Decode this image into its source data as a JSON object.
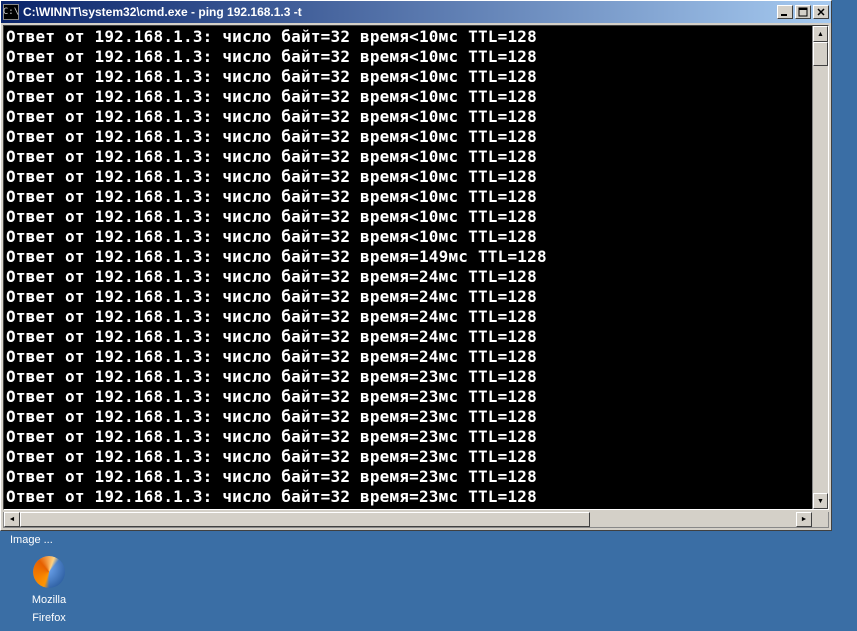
{
  "window": {
    "title": "C:\\WINNT\\system32\\cmd.exe - ping 192.168.1.3 -t",
    "icon_text": "C:\\"
  },
  "console": {
    "lines": [
      "Ответ от 192.168.1.3: число байт=32 время<10мс TTL=128",
      "Ответ от 192.168.1.3: число байт=32 время<10мс TTL=128",
      "Ответ от 192.168.1.3: число байт=32 время<10мс TTL=128",
      "Ответ от 192.168.1.3: число байт=32 время<10мс TTL=128",
      "Ответ от 192.168.1.3: число байт=32 время<10мс TTL=128",
      "Ответ от 192.168.1.3: число байт=32 время<10мс TTL=128",
      "Ответ от 192.168.1.3: число байт=32 время<10мс TTL=128",
      "Ответ от 192.168.1.3: число байт=32 время<10мс TTL=128",
      "Ответ от 192.168.1.3: число байт=32 время<10мс TTL=128",
      "Ответ от 192.168.1.3: число байт=32 время<10мс TTL=128",
      "Ответ от 192.168.1.3: число байт=32 время<10мс TTL=128",
      "Ответ от 192.168.1.3: число байт=32 время=149мс TTL=128",
      "Ответ от 192.168.1.3: число байт=32 время=24мс TTL=128",
      "Ответ от 192.168.1.3: число байт=32 время=24мс TTL=128",
      "Ответ от 192.168.1.3: число байт=32 время=24мс TTL=128",
      "Ответ от 192.168.1.3: число байт=32 время=24мс TTL=128",
      "Ответ от 192.168.1.3: число байт=32 время=24мс TTL=128",
      "Ответ от 192.168.1.3: число байт=32 время=23мс TTL=128",
      "Ответ от 192.168.1.3: число байт=32 время=23мс TTL=128",
      "Ответ от 192.168.1.3: число байт=32 время=23мс TTL=128",
      "Ответ от 192.168.1.3: число байт=32 время=23мс TTL=128",
      "Ответ от 192.168.1.3: число байт=32 время=23мс TTL=128",
      "Ответ от 192.168.1.3: число байт=32 время=23мс TTL=128",
      "Ответ от 192.168.1.3: число байт=32 время=23мс TTL=128"
    ]
  },
  "desktop": {
    "truncated_label": "Image ...",
    "firefox_label_line1": "Mozilla",
    "firefox_label_line2": "Firefox"
  }
}
